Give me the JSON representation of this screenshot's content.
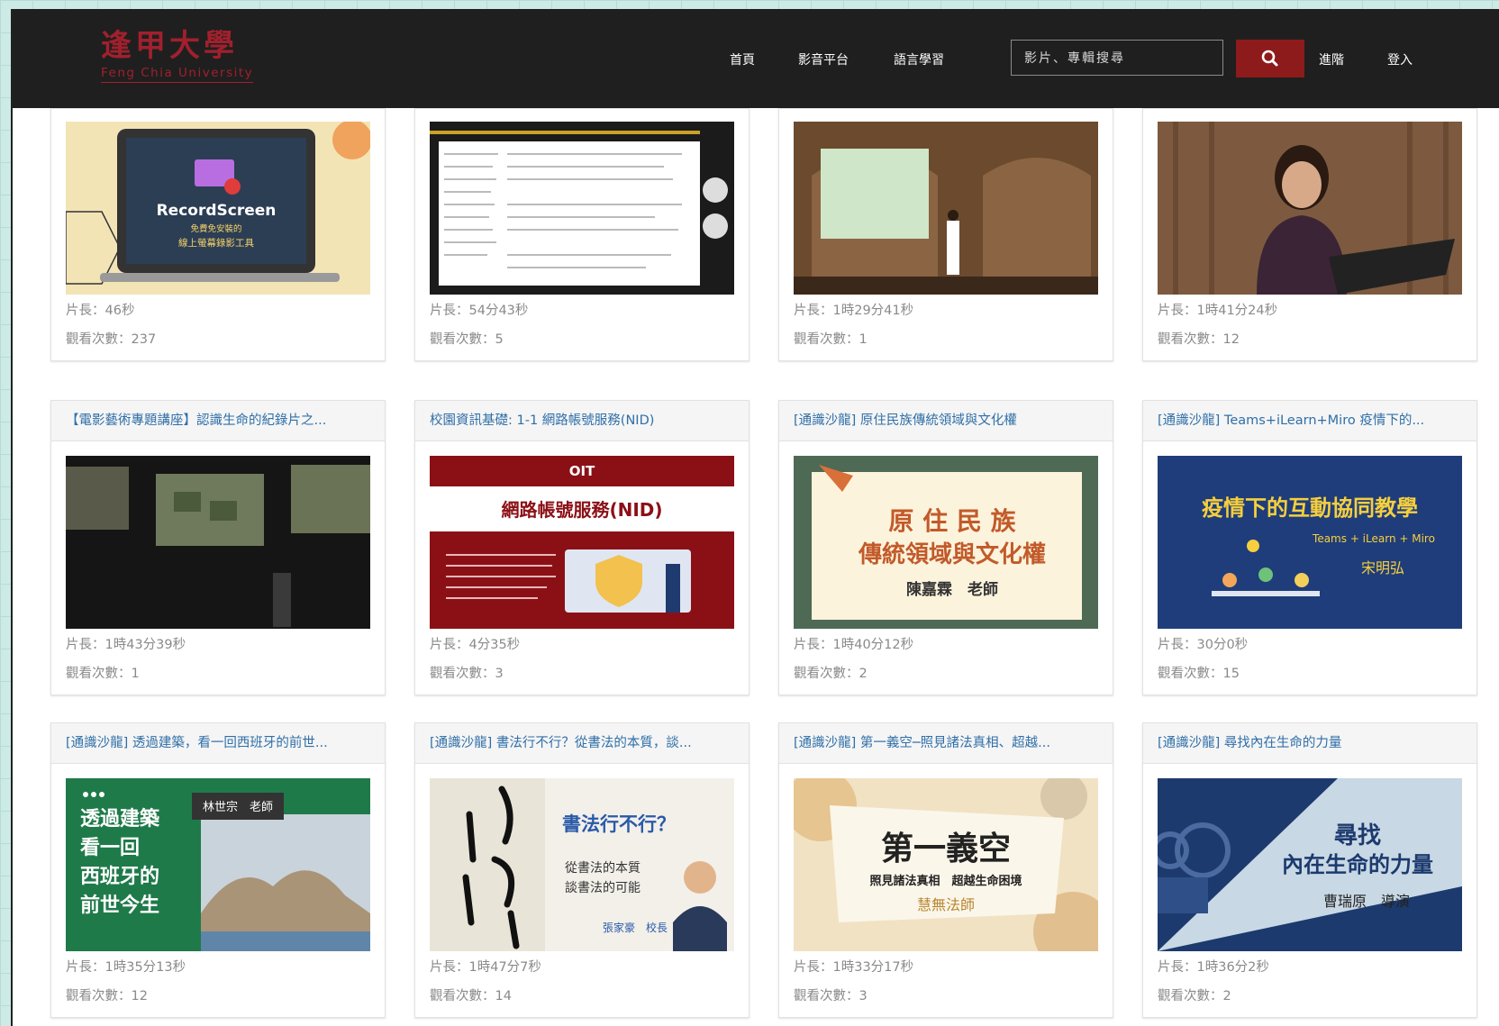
{
  "brand": {
    "name_cn": "逢甲大學",
    "name_en": "Feng Chia University",
    "color": "#a1202d"
  },
  "nav": {
    "home": "首頁",
    "media": "影音平台",
    "language": "語言學習",
    "advanced": "進階",
    "login": "登入"
  },
  "search": {
    "placeholder": "影片、專輯搜尋",
    "icon": "search-icon"
  },
  "labels": {
    "duration": "片長：",
    "views": "觀看次數："
  },
  "cards": [
    {
      "title": "",
      "duration": "46秒",
      "views": "237",
      "thumb_text": "RecordScreen",
      "thumb_sub1": "免費免安裝的",
      "thumb_sub2": "線上螢幕錄影工具"
    },
    {
      "title": "",
      "duration": "54分43秒",
      "views": "5"
    },
    {
      "title": "",
      "duration": "1時29分41秒",
      "views": "1"
    },
    {
      "title": "",
      "duration": "1時41分24秒",
      "views": "12"
    },
    {
      "title": "【電影藝術專題講座】認識生命的紀錄片之...",
      "duration": "1時43分39秒",
      "views": "1"
    },
    {
      "title": "校園資訊基礎: 1-1 網路帳號服務(NID)",
      "duration": "4分35秒",
      "views": "3",
      "thumb_text": "網路帳號服務(NID)",
      "thumb_logo": "OIT"
    },
    {
      "title": "[通識沙龍] 原住民族傳統領域與文化權",
      "duration": "1時40分12秒",
      "views": "2",
      "thumb_text1": "原 住 民 族",
      "thumb_text2": "傳統領域與文化權",
      "thumb_text3": "陳嘉霖　老師"
    },
    {
      "title": "[通識沙龍] Teams+iLearn+Miro 疫情下的...",
      "duration": "30分0秒",
      "views": "15",
      "thumb_text1": "疫情下的互動協同教學",
      "thumb_text2": "Teams + iLearn + Miro",
      "thumb_text3": "宋明弘"
    },
    {
      "title": "[通識沙龍] 透過建築，看一回西班牙的前世...",
      "duration": "1時35分13秒",
      "views": "12",
      "thumb_lines": [
        "透過建築",
        "看一回",
        "西班牙的",
        "前世今生"
      ],
      "thumb_teacher": "林世宗　老師"
    },
    {
      "title": "[通識沙龍] 書法行不行？從書法的本質，談...",
      "duration": "1時47分7秒",
      "views": "14",
      "thumb_text1": "書法行不行？",
      "thumb_text2": "從書法的本質",
      "thumb_text3": "談書法的可能",
      "thumb_teacher": "張家豪　校長"
    },
    {
      "title": "[通識沙龍] 第一義空─照見諸法真相、超越...",
      "duration": "1時33分17秒",
      "views": "3",
      "thumb_text1": "第一義空",
      "thumb_text2": "照見諸法真相　超越生命困境",
      "thumb_teacher": "慧無法師"
    },
    {
      "title": "[通識沙龍] 尋找內在生命的力量",
      "duration": "1時36分2秒",
      "views": "2",
      "thumb_text1": "尋找",
      "thumb_text2": "內在生命的力量",
      "thumb_teacher": "曹瑞原　導演"
    }
  ]
}
